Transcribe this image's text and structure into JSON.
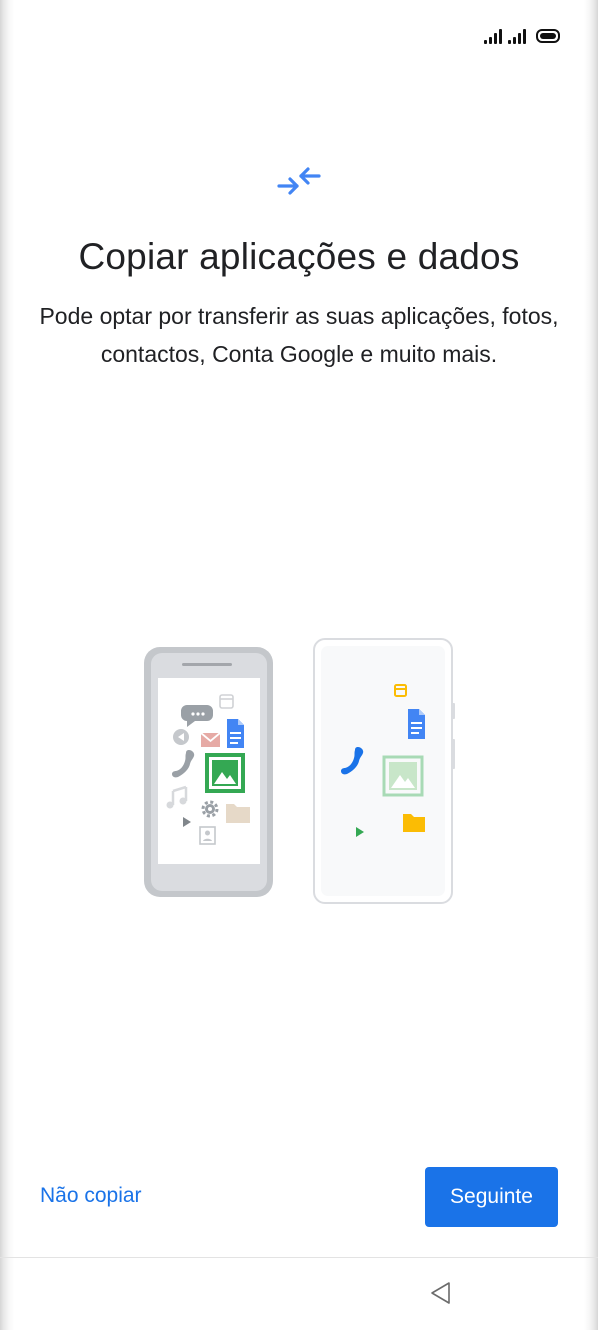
{
  "status_bar": {
    "icons": [
      "signal-icon",
      "signal-icon",
      "battery-icon"
    ]
  },
  "header": {
    "icon": "transfer-arrows-icon",
    "title": "Copiar aplicações e dados",
    "subtitle": "Pode optar por transferir as suas aplicações, fotos, contactos, Conta Google e muito mais."
  },
  "illustration": {
    "old_phone_icons": [
      "calendar-icon",
      "chat-icon",
      "play-circle-icon",
      "mail-icon",
      "docs-icon",
      "phone-icon",
      "photo-icon",
      "music-icon",
      "settings-icon",
      "folder-icon",
      "play-icon",
      "contact-icon"
    ],
    "new_phone_icons": [
      "calendar-icon",
      "docs-icon",
      "phone-icon",
      "photo-icon",
      "play-icon",
      "folder-icon"
    ]
  },
  "actions": {
    "skip_label": "Não copiar",
    "next_label": "Seguinte"
  },
  "navigation": {
    "back_icon": "back-triangle-icon"
  },
  "colors": {
    "accent": "#1a73e8",
    "text": "#202124",
    "background": "#ffffff"
  }
}
